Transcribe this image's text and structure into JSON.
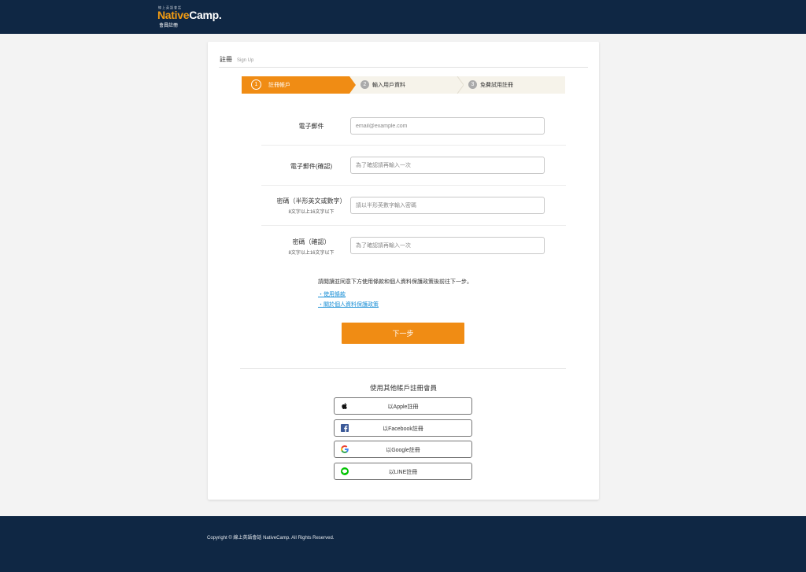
{
  "header": {
    "logo_tag": "線上英語會話",
    "logo_part1": "Native",
    "logo_part2": "Camp.",
    "logo_sub": "會員註冊"
  },
  "card": {
    "title": "註冊",
    "subtitle": "Sign Up"
  },
  "steps": [
    {
      "num": "1",
      "label": "註冊帳戶",
      "active": true
    },
    {
      "num": "2",
      "label": "輸入用戶資料",
      "active": false
    },
    {
      "num": "3",
      "label": "免費試用註冊",
      "active": false
    }
  ],
  "form": {
    "email": {
      "label": "電子郵件",
      "placeholder": "email@example.com",
      "value": ""
    },
    "email_confirm": {
      "label": "電子郵件(確認)",
      "placeholder": "為了確認請再輸入一次",
      "value": ""
    },
    "password": {
      "label": "密碼（半形英文或數字）",
      "hint": "8文字以上16文字以下",
      "placeholder": "請以半形英數字輸入密碼",
      "value": ""
    },
    "password_confirm": {
      "label": "密碼（確認）",
      "hint": "8文字以上16文字以下",
      "placeholder": "為了確認請再輸入一次",
      "value": ""
    }
  },
  "notice": "請閱讀並同意下方使用條款和個人資料保護政策後前往下一步。",
  "links": {
    "terms": "・使用條款",
    "privacy": "・關於個人資料保護政策"
  },
  "next_button": "下一步",
  "social": {
    "title": "使用其他帳戶註冊會員",
    "apple": "以Apple註冊",
    "facebook": "以Facebook註冊",
    "google": "以Google註冊",
    "line": "以LINE註冊"
  },
  "footer": {
    "copyright": "Copyright © 線上英語會話 NativeCamp. All Rights Reserved."
  },
  "colors": {
    "navy": "#0f2744",
    "accent": "#f08c14",
    "link": "#1a8fd6",
    "step_inactive_bg": "#f6f3ea"
  }
}
